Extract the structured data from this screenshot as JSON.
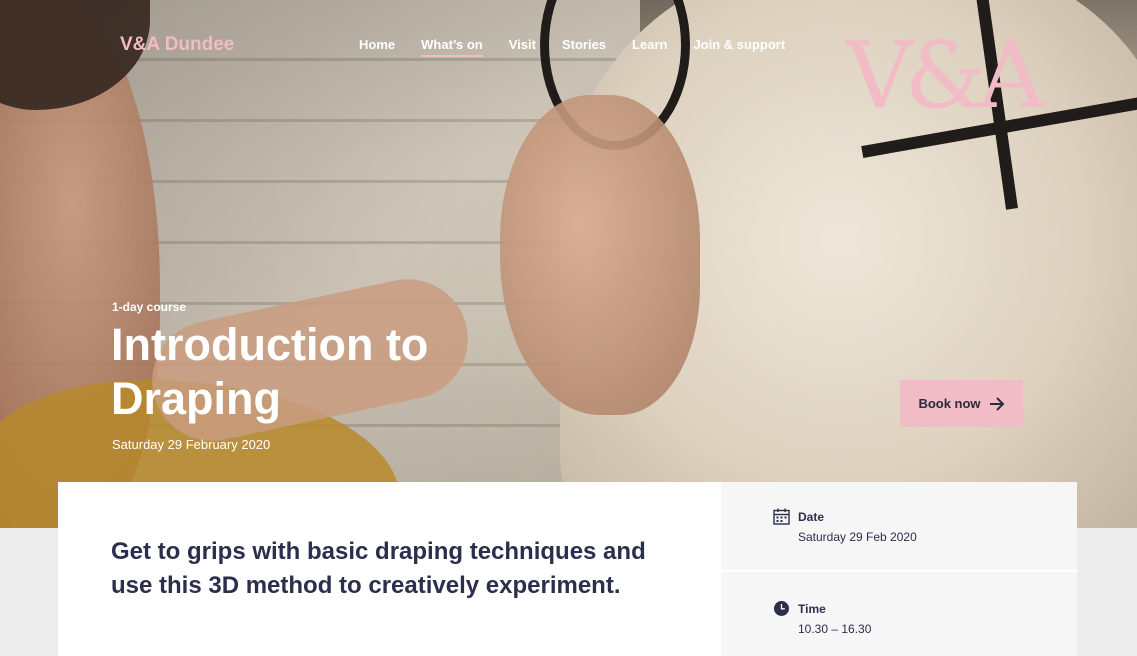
{
  "header": {
    "site_name": "V&A Dundee",
    "nav": [
      {
        "label": "Home",
        "active": false
      },
      {
        "label": "What’s on",
        "active": true
      },
      {
        "label": "Visit",
        "active": false
      },
      {
        "label": "Stories",
        "active": false
      },
      {
        "label": "Learn",
        "active": false
      },
      {
        "label": "Join & support",
        "active": false
      }
    ],
    "logo_text": "V&A"
  },
  "hero": {
    "eyebrow": "1-day course",
    "title": "Introduction to Draping",
    "date": "Saturday 29 February 2020",
    "book_label": "Book now",
    "book_icon": "arrow-right-icon"
  },
  "content": {
    "lead": "Get to grips with basic draping techniques and use this 3D method to creatively experiment."
  },
  "details": [
    {
      "icon": "calendar-icon",
      "label": "Date",
      "value": "Saturday 29 Feb 2020"
    },
    {
      "icon": "clock-icon",
      "label": "Time",
      "value": "10.30 – 16.30"
    }
  ],
  "colors": {
    "accent_pink": "#f2bcc6",
    "navy_text": "#2b2f4c",
    "panel_grey": "#f6f6f6"
  }
}
